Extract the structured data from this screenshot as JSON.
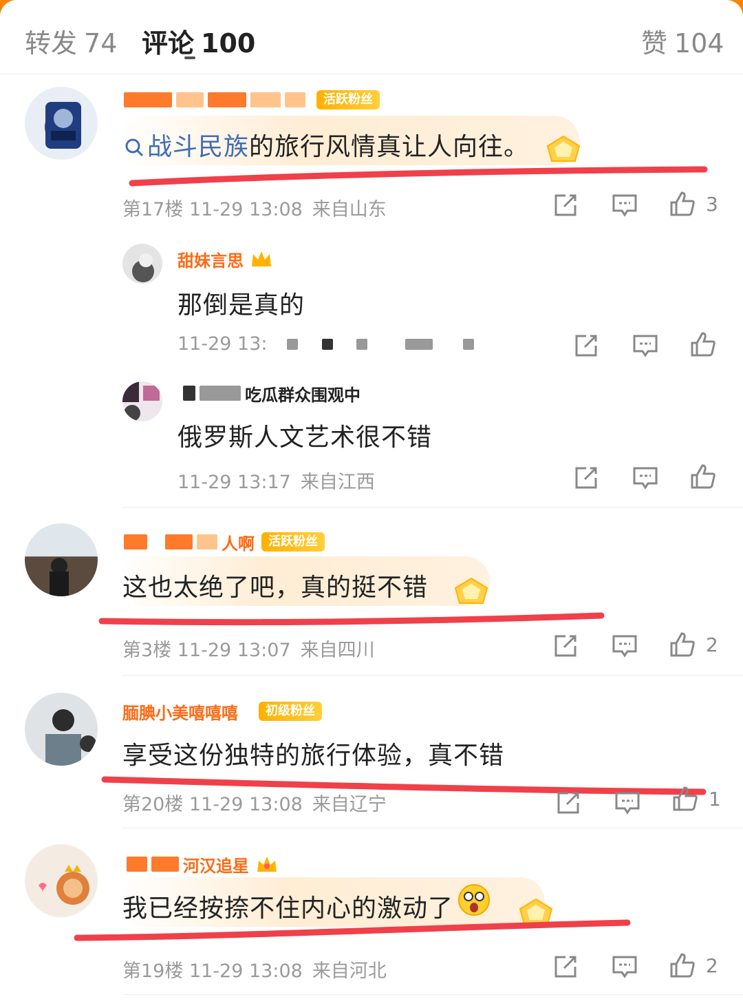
{
  "tabs": [
    {
      "label": "转发",
      "count": "74"
    },
    {
      "label": "评论",
      "count": "100"
    },
    {
      "label": "赞",
      "count": "104"
    }
  ],
  "comments": [
    {
      "username_visible": "",
      "badge": "活跃粉丝",
      "text_link": "战斗民族",
      "text_rest": "的旅行风情真让人向往。",
      "floor": "第17楼",
      "time": "11-29 13:08",
      "location": "来自山东",
      "likes": "3"
    },
    {
      "username_visible": "甜妹言思",
      "text": "那倒是真的",
      "time": "11-29 13:",
      "location": ""
    },
    {
      "username_visible": "吃瓜群众围观中",
      "text": "俄罗斯人文艺术很不错",
      "time": "11-29 13:17",
      "location": "来自江西"
    },
    {
      "username_visible": "人啊",
      "badge": "活跃粉丝",
      "text": "这也太绝了吧，真的挺不错",
      "floor": "第3楼",
      "time": "11-29 13:07",
      "location": "来自四川",
      "likes": "2"
    },
    {
      "username_visible": "腼腆小美嘻嘻嘻",
      "badge": "初级粉丝",
      "text": "享受这份独特的旅行体验，真不错",
      "floor": "第20楼",
      "time": "11-29 13:08",
      "location": "来自辽宁",
      "likes": "1"
    },
    {
      "username_visible": "河汉追星",
      "text": "我已经按捺不住内心的激动了",
      "floor": "第19楼",
      "time": "11-29 13:08",
      "location": "来自河北",
      "likes": "2"
    }
  ],
  "colors": {
    "accent": "#ff8200",
    "username": "#ff6a13",
    "link": "#3e6db5",
    "annotation_red": "#f0404a",
    "badge": "#ffb000"
  },
  "icons": [
    "search-icon",
    "share-icon",
    "comment-icon",
    "like-icon",
    "gem-icon",
    "crown-icon",
    "emoji-icon"
  ]
}
